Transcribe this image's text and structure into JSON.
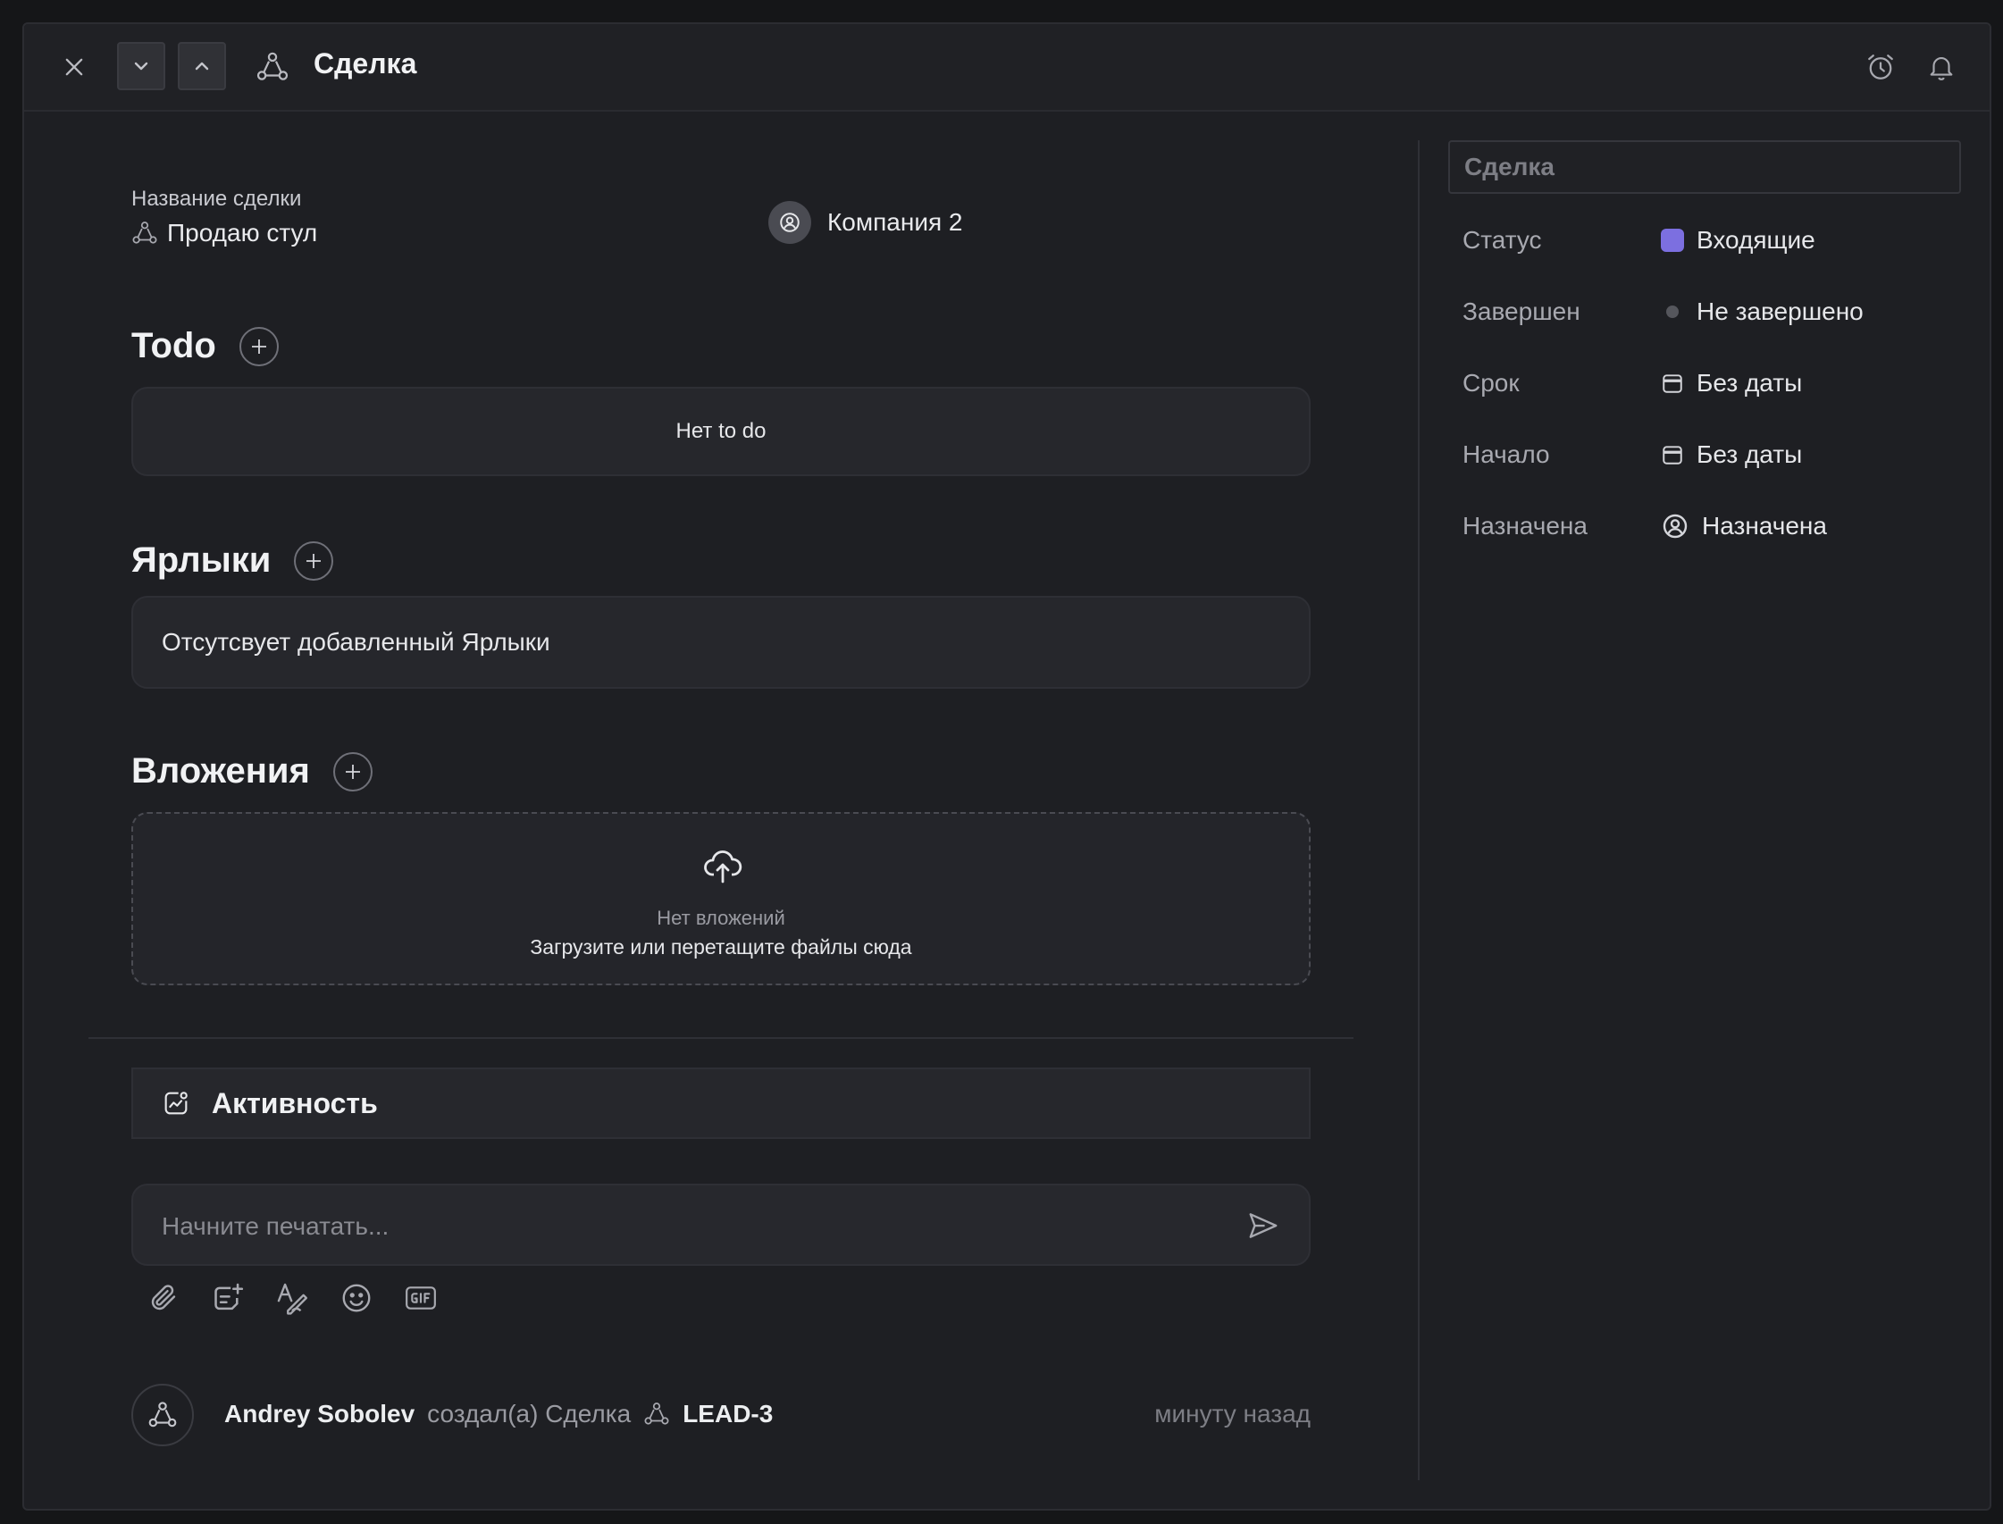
{
  "header": {
    "title": "Сделка"
  },
  "deal": {
    "name_label": "Название сделки",
    "name": "Продаю стул",
    "company": "Компания 2"
  },
  "todo": {
    "title": "Todo",
    "empty": "Нет to do"
  },
  "labels": {
    "title": "Ярлыки",
    "empty": "Отсутсвует добавленный Ярлыки"
  },
  "attachments": {
    "title": "Вложения",
    "empty_title": "Нет вложений",
    "empty_hint": "Загрузите или перетащите файлы сюда"
  },
  "activity": {
    "title": "Активность",
    "comment_placeholder": "Начните печатать...",
    "feed": [
      {
        "author": "Andrey Sobolev",
        "action": "создал(а) Сделка",
        "ref": "LEAD-3",
        "time": "минуту назад"
      }
    ]
  },
  "sidebar": {
    "title": "Сделка",
    "props": {
      "status": {
        "label": "Статус",
        "value": "Входящие",
        "color": "#7c6fe0"
      },
      "done": {
        "label": "Завершен",
        "value": "Не завершено"
      },
      "due": {
        "label": "Срок",
        "value": "Без даты"
      },
      "start": {
        "label": "Начало",
        "value": "Без даты"
      },
      "assignee": {
        "label": "Назначена",
        "value": "Назначена"
      }
    }
  },
  "icons": {
    "close": "close-icon",
    "down": "chevron-down-icon",
    "up": "chevron-up-icon",
    "type": "deal-icon",
    "alarm": "alarm-icon",
    "bell": "bell-icon",
    "upload": "cloud-upload-icon",
    "send": "send-icon",
    "attach": "paperclip-icon",
    "insert": "insert-text-icon",
    "format": "text-format-icon",
    "emoji": "emoji-icon",
    "gif": "gif-icon",
    "activity": "activity-icon"
  }
}
